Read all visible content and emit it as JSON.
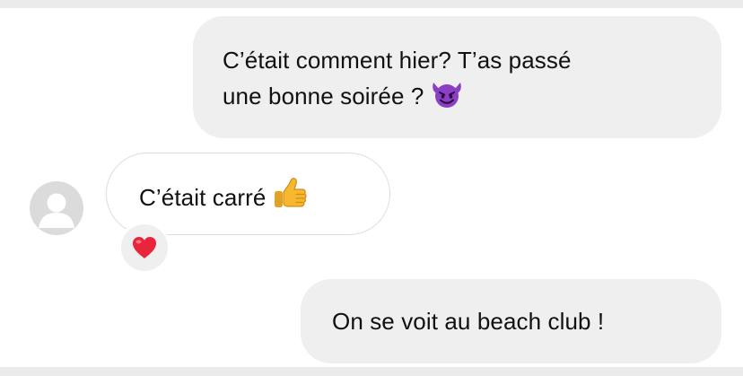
{
  "conversation": {
    "messages": [
      {
        "direction": "outgoing",
        "lines": [
          "C’était comment hier? T’as passé",
          "une bonne soirée ?"
        ],
        "emoji": "smiling-devil-emoji"
      },
      {
        "direction": "incoming",
        "text": "C’était carré",
        "emoji": "thumbs-up-emoji",
        "reaction": "red-heart-emoji",
        "avatar": "default-profile-avatar"
      },
      {
        "direction": "outgoing",
        "text": "On se voit au beach club !"
      }
    ]
  },
  "colors": {
    "outgoing_bubble": "#efefef",
    "incoming_border": "#dcdcdc",
    "avatar_bg": "#dbdbdb",
    "page_bg": "#ebebeb",
    "heart": "#e8253b",
    "devil": "#8a3fc4",
    "thumb": "#f5b82e"
  }
}
